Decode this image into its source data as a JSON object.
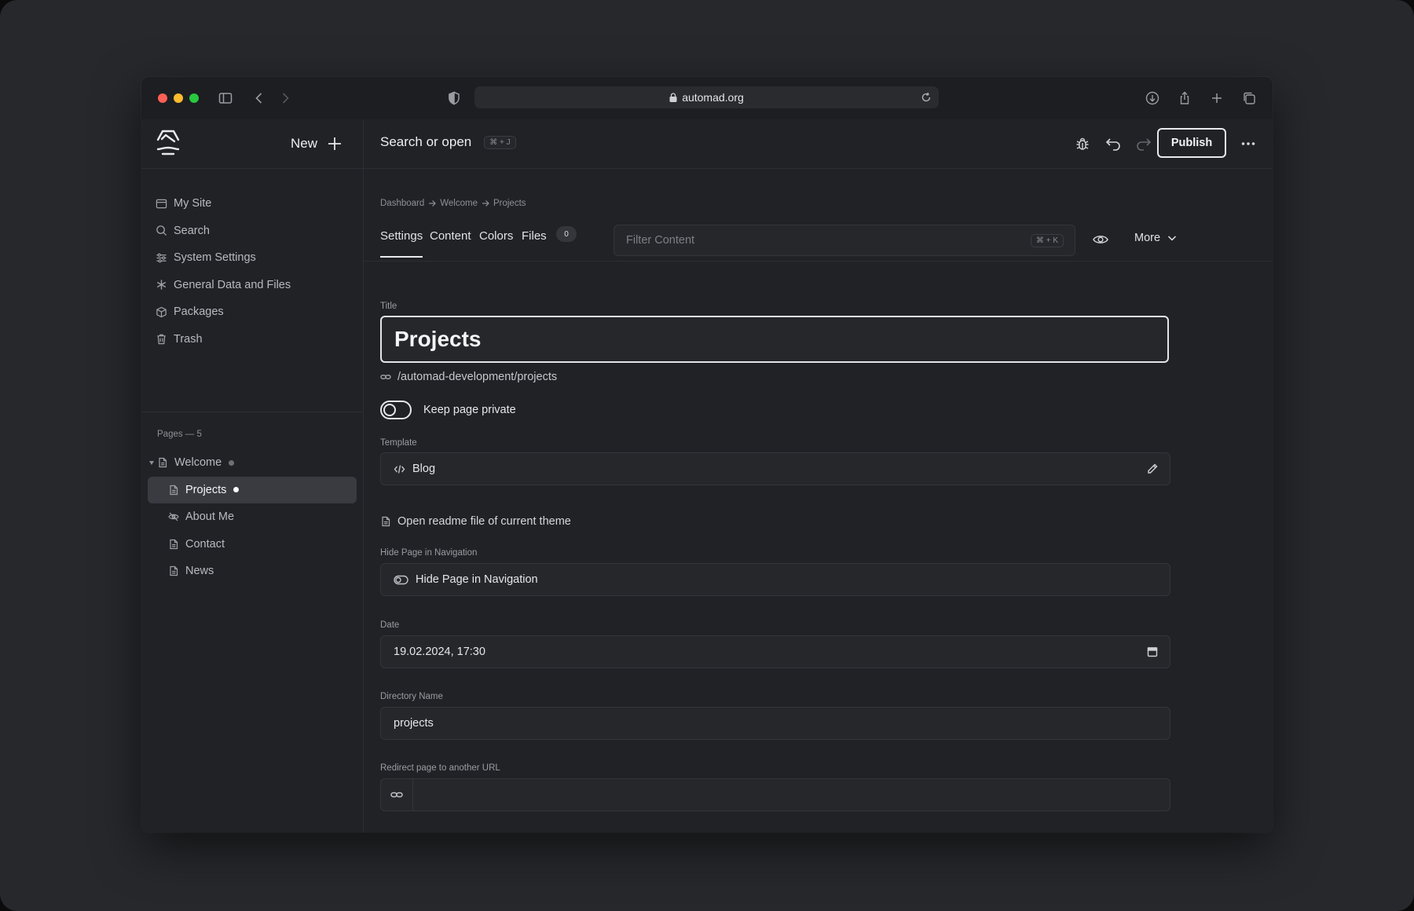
{
  "browser": {
    "url": "automad.org"
  },
  "sidebar": {
    "new_label": "New",
    "nav": [
      {
        "label": "My Site",
        "icon": "window-icon"
      },
      {
        "label": "Search",
        "icon": "search-icon"
      },
      {
        "label": "System Settings",
        "icon": "sliders-icon"
      },
      {
        "label": "General Data and Files",
        "icon": "asterisk-icon"
      },
      {
        "label": "Packages",
        "icon": "box-icon"
      },
      {
        "label": "Trash",
        "icon": "trash-icon"
      }
    ],
    "pages_label": "Pages — 5",
    "pages": [
      {
        "label": "Welcome",
        "icon": "page-icon",
        "dot_color": "#6e7076",
        "expanded": true
      },
      {
        "label": "Projects",
        "icon": "page-icon",
        "dot_color": "#ffffff",
        "active": true
      },
      {
        "label": "About Me",
        "icon": "eye-slash-icon"
      },
      {
        "label": "Contact",
        "icon": "page-icon"
      },
      {
        "label": "News",
        "icon": "page-icon"
      }
    ]
  },
  "header": {
    "search_label": "Search or open",
    "search_shortcut": "⌘ + J",
    "publish_label": "Publish"
  },
  "breadcrumb": [
    "Dashboard",
    "Welcome",
    "Projects"
  ],
  "tabs": [
    {
      "label": "Settings",
      "active": true
    },
    {
      "label": "Content"
    },
    {
      "label": "Colors"
    },
    {
      "label": "Files",
      "badge": "0"
    }
  ],
  "filter": {
    "placeholder": "Filter Content",
    "shortcut": "⌘ + K"
  },
  "more_label": "More",
  "form": {
    "title_label": "Title",
    "title_value": "Projects",
    "url_path": "/automad-development/projects",
    "private_label": "Keep page private",
    "private_on": false,
    "template_label": "Template",
    "template_value": "Blog",
    "readme_label": "Open readme file of current theme",
    "hide_nav_label": "Hide Page in Navigation",
    "hide_nav_toggle_label": "Hide Page in Navigation",
    "date_label": "Date",
    "date_value": "19.02.2024, 17:30",
    "directory_label": "Directory Name",
    "directory_value": "projects",
    "redirect_label": "Redirect page to another URL",
    "redirect_value": ""
  }
}
